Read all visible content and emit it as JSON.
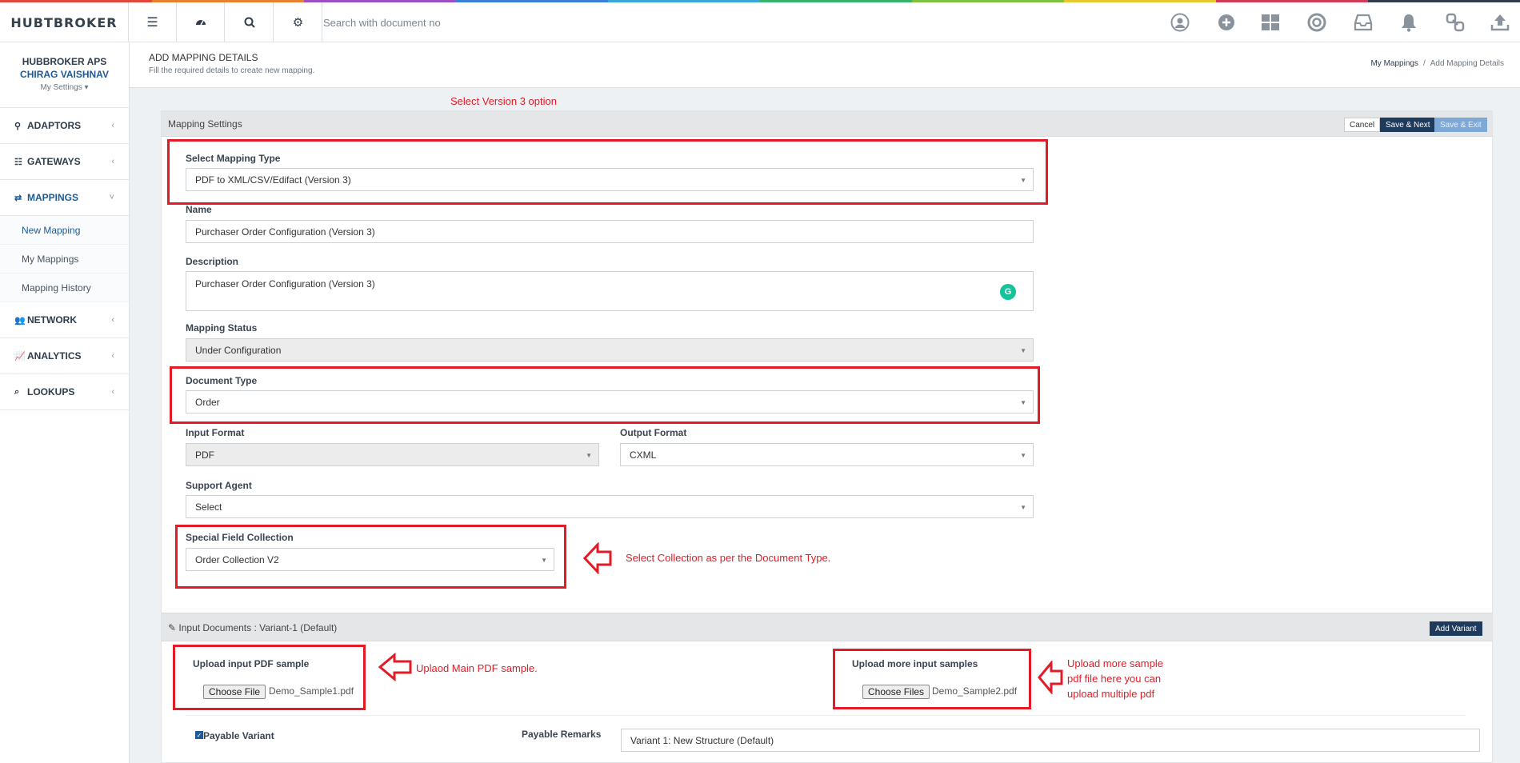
{
  "colors": {
    "annotation_red": "#e21b26",
    "brand_blue": "#1d5a96",
    "rainbow": [
      "#e0463a",
      "#e8802f",
      "#9c4fc2",
      "#3a7fd9",
      "#3aa9d9",
      "#38b26e",
      "#7fc242",
      "#e6c92e",
      "#d23a5a",
      "#2f3c4a"
    ]
  },
  "topbar": {
    "logo": "HUBTBROKER",
    "search_placeholder": "Search with document no",
    "left_icons": [
      "menu-icon",
      "dashboard-icon",
      "search-icon",
      "gear-icon"
    ],
    "right_icons": [
      "user-circle-icon",
      "plus-circle-icon",
      "grid-icon",
      "lifebuoy-icon",
      "inbox-icon",
      "bell-icon",
      "link-icon",
      "upload-icon"
    ]
  },
  "sidebar": {
    "org": "HUBBROKER APS",
    "user": "CHIRAG VAISHNAV",
    "settings": "My Settings",
    "items": [
      {
        "label": "ADAPTORS",
        "icon": "plug-icon"
      },
      {
        "label": "GATEWAYS",
        "icon": "sliders-icon"
      },
      {
        "label": "MAPPINGS",
        "icon": "exchange-icon"
      },
      {
        "label": "NETWORK",
        "icon": "users-icon"
      },
      {
        "label": "ANALYTICS",
        "icon": "line-chart-icon"
      },
      {
        "label": "LOOKUPS",
        "icon": "binoculars-icon"
      }
    ],
    "mapping_sub": [
      "New Mapping",
      "My Mappings",
      "Mapping History"
    ]
  },
  "header": {
    "title": "ADD MAPPING DETAILS",
    "subtitle": "Fill the required details to create new mapping.",
    "breadcrumb": [
      "My Mappings",
      "/",
      "Add Mapping Details"
    ]
  },
  "card": {
    "title": "Mapping Settings",
    "buttons": {
      "cancel": "Cancel",
      "save_next": "Save & Next",
      "save_exit": "Save & Exit"
    }
  },
  "form": {
    "mapping_type": {
      "label": "Select Mapping Type",
      "value": "PDF to XML/CSV/Edifact (Version 3)"
    },
    "name": {
      "label": "Name",
      "value": "Purchaser Order Configuration (Version 3)"
    },
    "description": {
      "label": "Description",
      "value": "Purchaser Order Configuration (Version 3)"
    },
    "status": {
      "label": "Mapping Status",
      "value": "Under Configuration"
    },
    "doc_type": {
      "label": "Document Type",
      "value": "Order"
    },
    "input_format": {
      "label": "Input Format",
      "value": "PDF"
    },
    "output_format": {
      "label": "Output Format",
      "value": "CXML"
    },
    "support_agent": {
      "label": "Support Agent",
      "value": "Select"
    },
    "special_field": {
      "label": "Special Field Collection",
      "value": "Order Collection V2"
    }
  },
  "variant": {
    "title": "Input Documents : Variant-1 (Default)",
    "add_button": "Add Variant",
    "upload_main_label": "Upload input PDF sample",
    "upload_main_button": "Choose File",
    "upload_main_file": "Demo_Sample1.pdf",
    "upload_more_label": "Upload more input samples",
    "upload_more_button": "Choose Files",
    "upload_more_file": "Demo_Sample2.pdf",
    "payable_label": "Payable Variant",
    "payable_checked": true,
    "remarks_label": "Payable Remarks",
    "remarks_value": "Variant 1: New Structure (Default)"
  },
  "annotations": {
    "version3": "Select Version 3 option",
    "collection": "Select Collection as per the Document Type.",
    "main_pdf": "Uplaod Main PDF sample.",
    "more_pdf": [
      "Upload more sample",
      "pdf file here you can",
      "upload multiple pdf"
    ]
  }
}
